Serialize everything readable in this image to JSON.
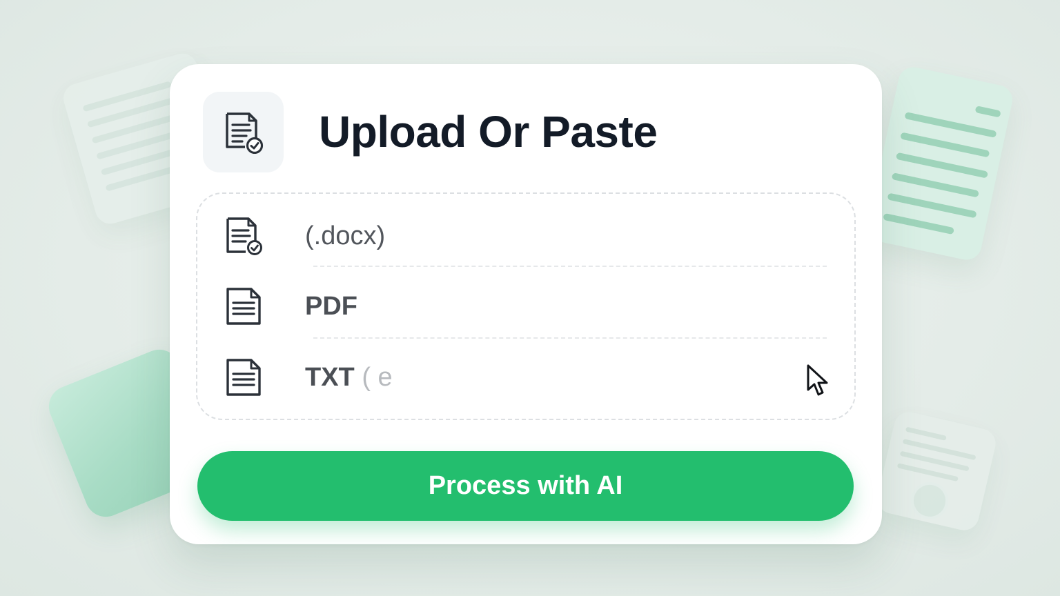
{
  "header": {
    "title": "Upload Or Paste",
    "icon": "document-check-icon"
  },
  "dropzone": {
    "items": [
      {
        "label": "(.docx)",
        "faded_suffix": "",
        "icon": "document-check-icon"
      },
      {
        "label": "PDF",
        "faded_suffix": "",
        "icon": "document-icon"
      },
      {
        "label": "TXT",
        "faded_suffix": " ( e",
        "icon": "document-icon"
      }
    ]
  },
  "actions": {
    "process_label": "Process with AI"
  },
  "colors": {
    "accent": "#23be6e",
    "title_text": "#131b27",
    "card_bg": "#ffffff",
    "page_bg": "#e4ece8"
  }
}
